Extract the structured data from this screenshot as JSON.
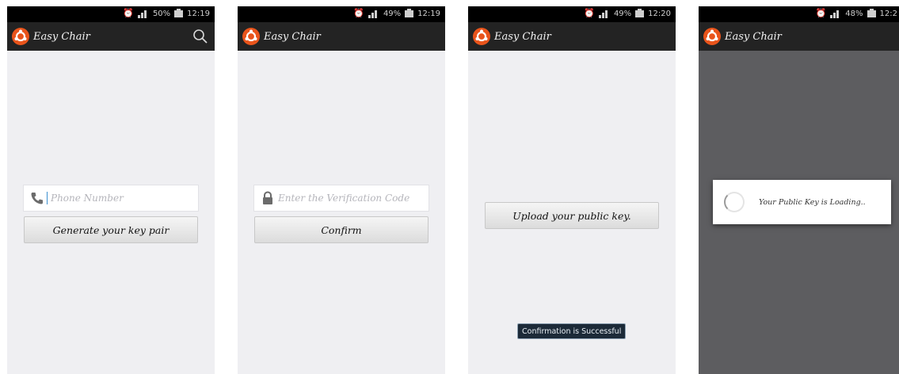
{
  "app": {
    "title": "Easy Chair"
  },
  "screens": [
    {
      "status": {
        "battery": "50%",
        "time": "12:19"
      },
      "phone_input": {
        "placeholder": "Phone Number"
      },
      "generate_button": "Generate your key pair"
    },
    {
      "status": {
        "battery": "49%",
        "time": "12:19"
      },
      "code_input": {
        "placeholder": "Enter the Verification Code"
      },
      "confirm_button": "Confirm"
    },
    {
      "status": {
        "battery": "49%",
        "time": "12:20"
      },
      "upload_button": "Upload your public key.",
      "toast": "Confirmation is Successful"
    },
    {
      "status": {
        "battery": "48%",
        "time": "12:2"
      },
      "dialog_text": "Your Public Key is Loading.."
    }
  ],
  "colors": {
    "accent": "#e9541b",
    "actionbar": "#232323",
    "background": "#efeff2",
    "dim": "#5d5d60"
  },
  "icons": [
    "alarm-icon",
    "signal-icon",
    "battery-icon",
    "search-icon",
    "phone-icon",
    "lock-icon",
    "spinner-icon"
  ]
}
